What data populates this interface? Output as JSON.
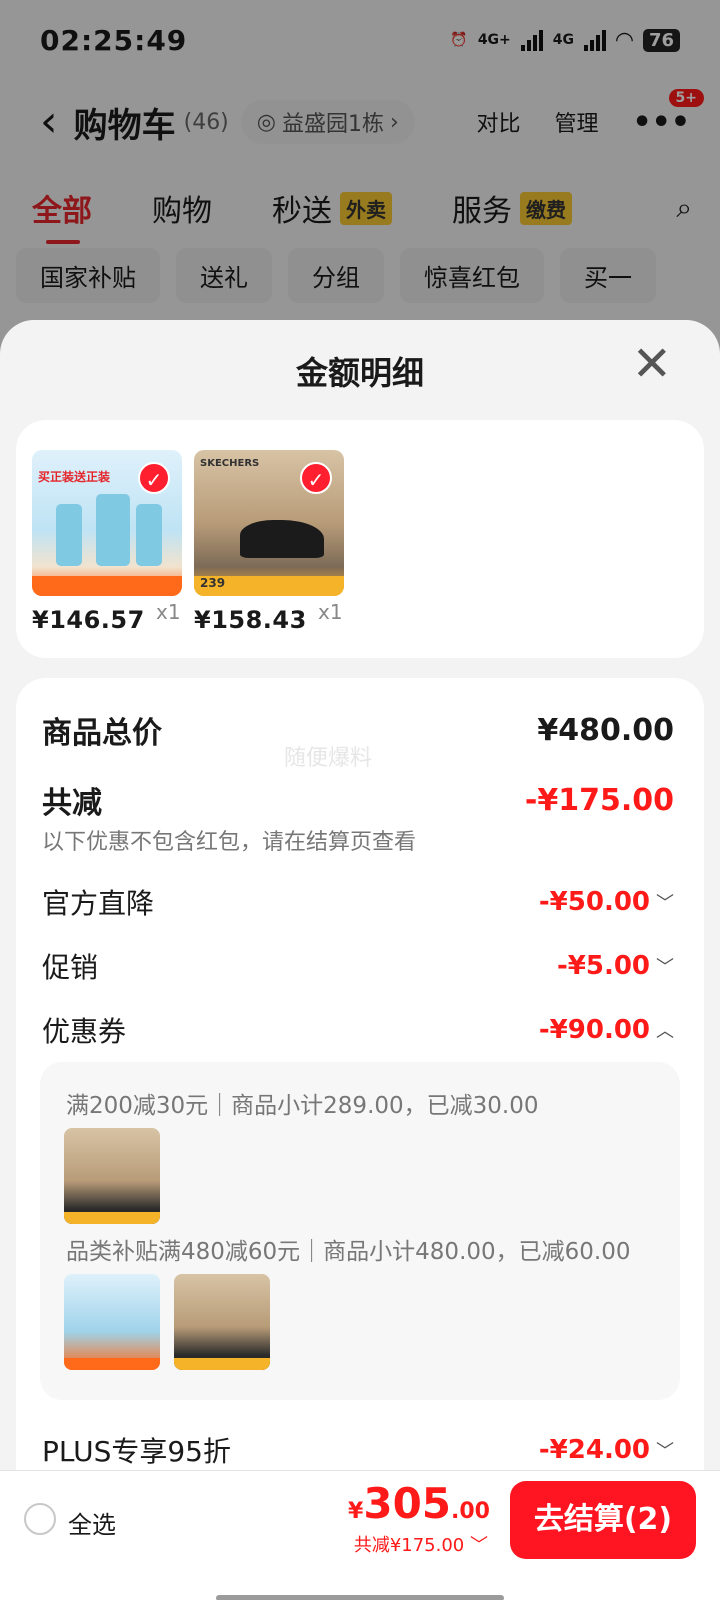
{
  "status": {
    "time": "02:25:49",
    "net1": "4G+",
    "net2": "4G",
    "battery": "76"
  },
  "cart": {
    "title": "购物车",
    "count": "(46)",
    "location": "益盛园1栋",
    "compare": "对比",
    "manage": "管理",
    "badge": "5+",
    "tabs": [
      {
        "label": "全部",
        "tag": ""
      },
      {
        "label": "购物",
        "tag": ""
      },
      {
        "label": "秒送",
        "tag": "外卖"
      },
      {
        "label": "服务",
        "tag": "缴费"
      }
    ],
    "chips": [
      "国家补贴",
      "送礼",
      "分组",
      "惊喜红包",
      "买一"
    ]
  },
  "sheet": {
    "title": "金额明细",
    "products": [
      {
        "price": "¥146.57",
        "qty": "x1",
        "image": "everneden-618-skincare",
        "image_text": "买正装送正装"
      },
      {
        "price": "¥158.43",
        "qty": "x1",
        "image": "skechers-black-shoes",
        "image_text": "SKECHERS",
        "image_price": "239"
      }
    ],
    "subtotal_label": "商品总价",
    "subtotal": "¥480.00",
    "watermark": "随便爆料",
    "total_reduction_label": "共减",
    "total_reduction": "-¥175.00",
    "note": "以下优惠不包含红包，请在结算页查看",
    "lines": [
      {
        "label": "官方直降",
        "value": "-¥50.00",
        "expanded": false
      },
      {
        "label": "促销",
        "value": "-¥5.00",
        "expanded": false
      },
      {
        "label": "优惠券",
        "value": "-¥90.00",
        "expanded": true
      }
    ],
    "coupons": [
      {
        "text": "满200减30元｜商品小计289.00，已减30.00"
      },
      {
        "text": "品类补贴满480减60元｜商品小计480.00，已减60.00"
      }
    ],
    "plus_label": "PLUS专享95折",
    "plus_value": "-¥24.00"
  },
  "bottom": {
    "select_all": "全选",
    "currency": "¥",
    "total_int": "305",
    "total_dec": ".00",
    "saved": "共减¥175.00",
    "checkout": "去结算(2)"
  },
  "colors": {
    "accent": "#ff1a1a",
    "tag": "#f7c733",
    "checkout": "#ff1521"
  }
}
